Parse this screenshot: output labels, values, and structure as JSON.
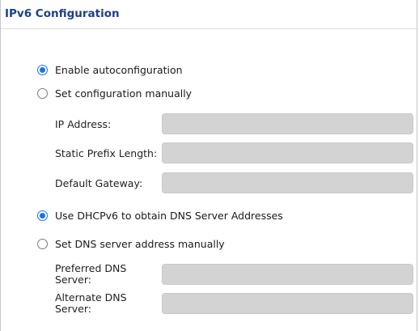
{
  "section": {
    "title": "IPv6 Configuration"
  },
  "address_mode": {
    "auto_label": "Enable autoconfiguration",
    "auto_selected": true,
    "manual_label": "Set configuration manually",
    "manual_selected": false
  },
  "fields": {
    "ip_address": {
      "label": "IP Address:",
      "value": ""
    },
    "prefix_length": {
      "label": "Static Prefix Length:",
      "value": ""
    },
    "gateway": {
      "label": "Default Gateway:",
      "value": ""
    }
  },
  "dns_mode": {
    "dhcp_label": "Use DHCPv6 to obtain DNS Server Addresses",
    "dhcp_selected": true,
    "manual_label": "Set DNS server address manually",
    "manual_selected": false
  },
  "dns_fields": {
    "preferred": {
      "label_line1": "Preferred DNS",
      "label_line2": "Server:",
      "value": ""
    },
    "alternate": {
      "label_line1": "Alternate DNS",
      "label_line2": "Server:",
      "value": ""
    }
  },
  "colors": {
    "title": "#1d3f8a",
    "radio_accent": "#1a73e8",
    "input_disabled_bg": "#d3d3d3"
  }
}
